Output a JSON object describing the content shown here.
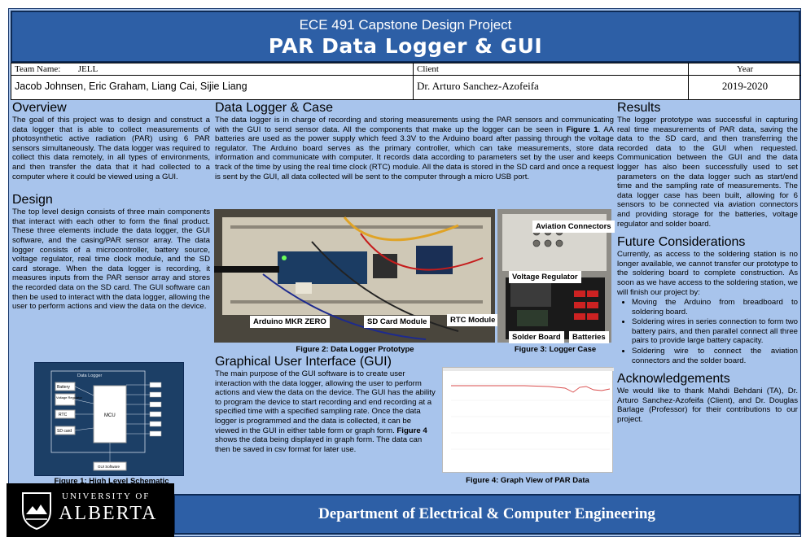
{
  "header": {
    "subtitle": "ECE 491 Capstone Design Project",
    "title": "PAR Data Logger & GUI"
  },
  "info": {
    "team_label": "Team Name:",
    "team_name": "JELL",
    "members": "Jacob Johnsen, Eric Graham, Liang Cai, Sijie Liang",
    "client_label": "Client",
    "client": "Dr. Arturo Sanchez-Azofeifa",
    "year_label": "Year",
    "year": "2019-2020"
  },
  "overview": {
    "title": "Overview",
    "text": "The goal of this project was to design and construct a data logger that is able to collect measurements of photosynthetic active radiation (PAR) using 6 PAR sensors simultaneously. The data logger was required to collect this data remotely, in all types of environments, and then transfer the data that it had collected to a computer where it could be viewed using a GUI."
  },
  "design": {
    "title": "Design",
    "text": "The top level design consists of three main components that interact with each other to form the final product. These three elements include the data logger, the GUI software, and the casing/PAR sensor array. The data logger consists of a microcontroller, battery source, voltage regulator, real time clock module, and the SD card storage. When the data logger is recording, it measures inputs from the PAR sensor array and stores the recorded data on the SD card. The GUI software can then be used to interact with the data logger, allowing the user to perform actions and view the data on the device."
  },
  "schematic": {
    "title": "Data Logger",
    "blocks": [
      "Battery",
      "Voltage Regulator",
      "RTC",
      "SD card"
    ],
    "mcu": "MCU",
    "gui": "GUI Software",
    "caption": "Figure 1: High Level Schematic"
  },
  "datalogger": {
    "title": "Data Logger & Case",
    "text_a": "The data logger is in charge of recording and storing measurements using the PAR sensors and communicating with the GUI to send sensor data. All the components that make up the logger can be seen in ",
    "fig_ref": "Figure 1",
    "text_b": ". AA batteries are used as the power supply which feed 3.3V to the Arduino board after passing through the voltage regulator. The Arduino board serves as the primary controller, which can take measurements, store data information and communicate with computer. It records data according to parameters set by the user and keeps track of the time by using the real time clock (RTC) module. All the data is stored in the SD card and once a request is sent by the GUI,  all data collected will be sent to the computer through a micro USB port."
  },
  "figure2": {
    "labels": [
      "Arduino MKR ZERO",
      "SD Card Module",
      "RTC Module"
    ],
    "caption": "Figure 2: Data Logger Prototype"
  },
  "figure3": {
    "labels": [
      "Aviation Connectors",
      "Voltage Regulator",
      "Solder Board",
      "Batteries"
    ],
    "caption": "Figure 3: Logger Case"
  },
  "gui": {
    "title": "Graphical User Interface (GUI)",
    "text_a": "The main purpose of the GUI software is to create user interaction with the data logger, allowing the user to perform actions and view the data on the device. The GUI has the ability to program the device to start recording and end recording at a specified time with a specified sampling rate. Once the data logger is programmed and the data is collected, it can be viewed in the GUI in either table form or graph form. ",
    "fig_ref": "Figure 4",
    "text_b": " shows the data being displayed in graph form. The data can then be saved in csv format for later use."
  },
  "figure4": {
    "caption": "Figure 4: Graph View of PAR Data"
  },
  "results": {
    "title": "Results",
    "text": "The logger prototype was successful in capturing real time measurements of PAR data, saving the data to the SD card, and then transferring the recorded data to the GUI when requested. Communication between the GUI and the data logger has also been successfully used to set parameters on the data logger such as start/end time and the sampling rate of measurements. The data logger case has been built, allowing for 6 sensors to be connected via aviation connectors and providing storage for the batteries, voltage regulator and solder board."
  },
  "future": {
    "title": "Future Considerations",
    "text": "Currently, as access to  the soldering station is no longer available, we cannot transfer our prototype to the soldering board to complete construction. As soon as we have access to the soldering station, we will finish our project by:",
    "items": [
      "Moving the Arduino from breadboard to soldering board.",
      "Soldering wires in  series connection to form two battery pairs, and then parallel connect all three pairs to provide large battery capacity.",
      "Soldering wire to connect the aviation connectors and the solder board."
    ]
  },
  "ack": {
    "title": "Acknowledgements",
    "text": "We would like to thank Mahdi Behdani (TA), Dr. Arturo Sanchez-Azofeifa (Client), and Dr. Douglas Barlage (Professor) for their contributions to our project."
  },
  "footer": {
    "university_line": "UNIVERSITY OF",
    "university_name": "ALBERTA",
    "department": "Department of Electrical & Computer Engineering"
  },
  "colors": {
    "background": "#a8c4ec",
    "banner": "#2d5fa6",
    "border": "#0d2a55"
  }
}
